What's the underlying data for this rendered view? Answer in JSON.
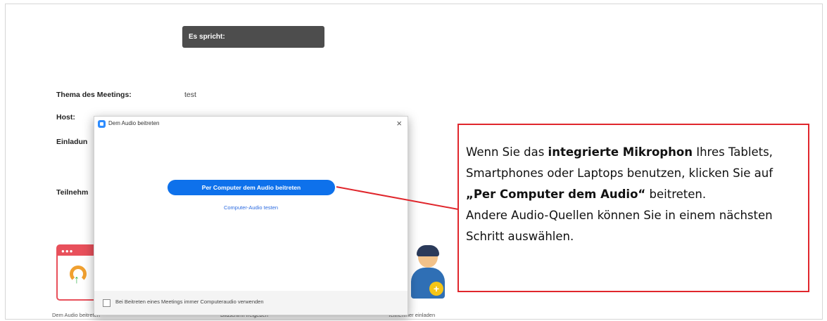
{
  "speaking_bar": {
    "label": "Es spricht:"
  },
  "meeting_info": {
    "topic_label": "Thema des Meetings:",
    "topic_value": "test",
    "host_label": "Host:",
    "invite_label": "Einladun",
    "participants_label": "Teilnehm"
  },
  "bottom_tiles": {
    "audio_label": "Dem Audio beitreten",
    "share_label": "Bildschirm freigeben",
    "invite_label": "Teilnehmer einladen"
  },
  "dialog": {
    "title": "Dem Audio beitreten",
    "close_glyph": "×",
    "join_button": "Per Computer dem Audio beitreten",
    "test_link": "Computer-Audio testen",
    "checkbox_label": "Bei Beitreten eines Meetings immer Computeraudio verwenden"
  },
  "callout": {
    "t1": "Wenn Sie das ",
    "b1": "integrierte Mikrophon",
    "t2": " Ihres Tablets, Smartphones oder Laptops benutzen, klicken Sie auf ",
    "b2": "„Per Computer dem Audio“",
    "t3": " beitreten.",
    "t4": "Andere Audio-Quellen können Sie in einem nächsten Schritt auswählen."
  },
  "colors": {
    "accent_blue": "#0e71eb",
    "callout_red": "#e0262c",
    "speaking_bg": "#4d4d4d"
  },
  "icons": [
    "zoom-app-icon",
    "close-icon",
    "headphones-icon",
    "invite-user-icon",
    "checkbox-icon"
  ]
}
